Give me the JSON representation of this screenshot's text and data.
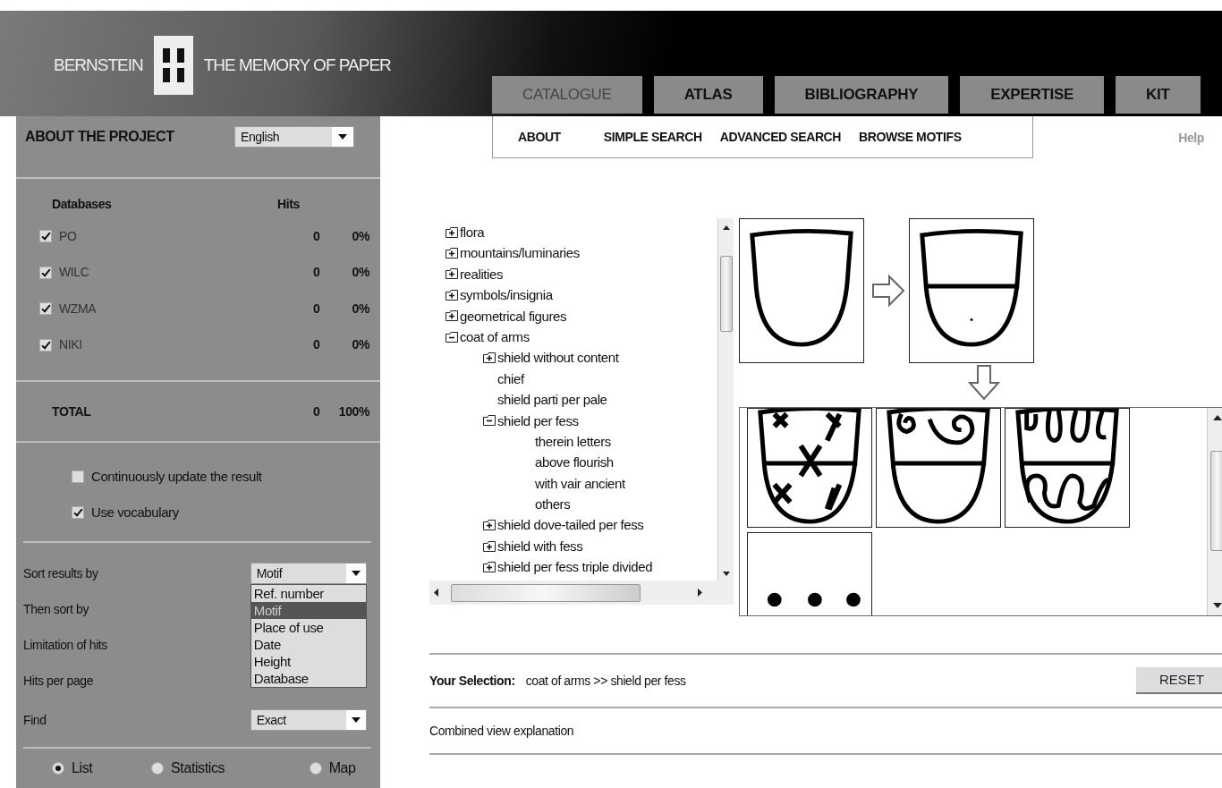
{
  "header": {
    "brand": "BERNSTEIN",
    "tagline": "THE MEMORY OF PAPER"
  },
  "tabs": [
    {
      "label": "CATALOGUE",
      "selected": true
    },
    {
      "label": "ATLAS",
      "selected": false
    },
    {
      "label": "BIBLIOGRAPHY",
      "selected": false
    },
    {
      "label": "EXPERTISE",
      "selected": false
    },
    {
      "label": "KIT",
      "selected": false
    }
  ],
  "subnav": [
    {
      "label": "ABOUT"
    },
    {
      "label": "SIMPLE SEARCH"
    },
    {
      "label": "ADVANCED SEARCH"
    },
    {
      "label": "BROWSE MOTIFS"
    }
  ],
  "help": "Help",
  "sidebar": {
    "about": "ABOUT THE PROJECT",
    "language": "English",
    "databases": {
      "columns": [
        "Databases",
        "Hits"
      ],
      "rows": [
        {
          "name": "PO",
          "checked": true,
          "hits": "0",
          "percent": "0%"
        },
        {
          "name": "WILC",
          "checked": true,
          "hits": "0",
          "percent": "0%"
        },
        {
          "name": "WZMA",
          "checked": true,
          "hits": "0",
          "percent": "0%"
        },
        {
          "name": "NIKI",
          "checked": true,
          "hits": "0",
          "percent": "0%"
        }
      ],
      "total": {
        "label": "TOTAL",
        "hits": "0",
        "percent": "100%"
      }
    },
    "options": [
      {
        "label": "Continuously update the result",
        "checked": false
      },
      {
        "label": "Use vocabulary",
        "checked": true
      }
    ],
    "sort_fields": [
      {
        "label": "Sort results by",
        "value": "Motif",
        "open": true,
        "options": [
          {
            "label": "Ref. number",
            "selected": false
          },
          {
            "label": "Motif",
            "selected": true
          },
          {
            "label": "Place of use",
            "selected": false
          },
          {
            "label": "Date",
            "selected": false
          },
          {
            "label": "Height",
            "selected": false
          },
          {
            "label": "Database",
            "selected": false
          }
        ]
      },
      {
        "label": "Then sort by"
      },
      {
        "label": "Limitation of hits"
      },
      {
        "label": "Hits per page"
      },
      {
        "label": "Find",
        "value": "Exact",
        "open": false
      }
    ],
    "views": [
      {
        "label": "List",
        "selected": true
      },
      {
        "label": "Statistics",
        "selected": false
      },
      {
        "label": "Map",
        "selected": false
      }
    ]
  },
  "tree": [
    {
      "label": "flora",
      "kind": "folder",
      "expanded": false
    },
    {
      "label": "mountains/luminaries",
      "kind": "folder",
      "expanded": false
    },
    {
      "label": "realities",
      "kind": "folder",
      "expanded": false
    },
    {
      "label": "symbols/insignia",
      "kind": "folder",
      "expanded": false
    },
    {
      "label": "geometrical figures",
      "kind": "folder",
      "expanded": false
    },
    {
      "label": "coat of arms",
      "kind": "folder",
      "expanded": true,
      "children": [
        {
          "label": "shield without content",
          "kind": "folder",
          "expanded": false
        },
        {
          "label": "chief",
          "kind": "leaf"
        },
        {
          "label": "shield parti per pale",
          "kind": "leaf"
        },
        {
          "label": "shield per fess",
          "kind": "folder",
          "expanded": true,
          "children": [
            {
              "label": "therein letters",
              "kind": "leaf"
            },
            {
              "label": "above flourish",
              "kind": "leaf"
            },
            {
              "label": "with vair ancient",
              "kind": "leaf"
            },
            {
              "label": "others",
              "kind": "leaf"
            }
          ]
        },
        {
          "label": "shield dove-tailed per fess",
          "kind": "folder",
          "expanded": false
        },
        {
          "label": "shield with fess",
          "kind": "folder",
          "expanded": false
        },
        {
          "label": "shield per fess triple divided",
          "kind": "folder",
          "expanded": false
        }
      ]
    }
  ],
  "selection": {
    "label": "Your Selection:",
    "value": "coat of arms >> shield per fess"
  },
  "reset": "RESET",
  "explanation": "Combined view explanation"
}
